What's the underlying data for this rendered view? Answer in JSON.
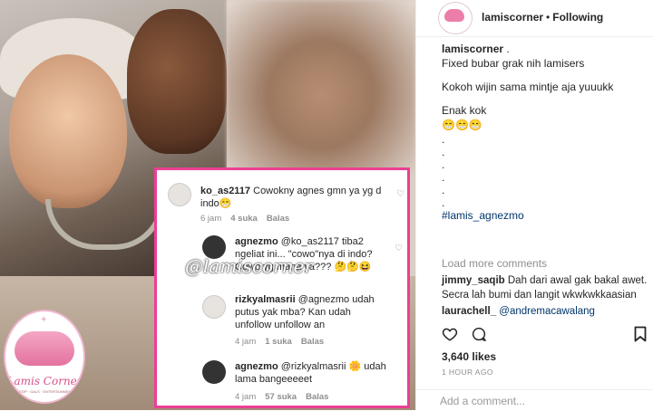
{
  "comment_card": {
    "comments": [
      {
        "user": "ko_as2117",
        "text": "Cowokny agnes gmn ya yg d indo😁",
        "time": "6 jam",
        "likes": "4 suka",
        "reply": "Balas"
      },
      {
        "user": "agnezmo",
        "mention": "@ko_as2117",
        "text": "tiba2 ngeliat ini... \"cowo\"nya di indo? Cowo yg mana ya??? 🤔🤔😆"
      },
      {
        "user": "rizkyalmasrii",
        "mention": "@agnezmo",
        "text": "udah putus yak mba? Kan udah unfollow unfollow an",
        "time": "4 jam",
        "likes": "1 suka",
        "reply": "Balas"
      },
      {
        "user": "agnezmo",
        "mention": "@rizkyalmasrii",
        "text": "🌼 udah lama bangeeeeet",
        "time": "4 jam",
        "likes": "57 suka",
        "reply": "Balas"
      }
    ],
    "watermark": "@lamiscorner"
  },
  "logo": {
    "title": "Lamis Corner",
    "subtitle": "GOSSIP · GALS · ENTERTAINMENTS"
  },
  "header": {
    "username": "lamiscorner",
    "separator": "•",
    "follow_state": "Following"
  },
  "caption": {
    "username": "lamiscorner",
    "suffix": " .",
    "lines": [
      "Fixed bubar grak nih lamisers",
      "Kokoh wijin sama mintje aja yuuukk",
      "Enak kok",
      "😁😁😁"
    ],
    "dots": [
      ".",
      ".",
      ".",
      ".",
      ".",
      "."
    ],
    "hashtag": "#lamis_agnezmo"
  },
  "load_more": "Load more comments",
  "comments": [
    {
      "user": "jimmy_saqib",
      "text": "Dah dari awal gak bakal awet. Secra lah bumi dan langit wkwkwkkaasian"
    },
    {
      "user": "laurachell_",
      "mention": "@andremacawalang"
    }
  ],
  "likes": "3,640 likes",
  "timestamp": "1 HOUR AGO",
  "add_comment": {
    "placeholder": "Add a comment..."
  },
  "colors": {
    "accent": "#ec3f93",
    "link": "#003569",
    "muted": "#8e8e8e"
  },
  "icons": [
    "heart-icon",
    "comment-icon",
    "bookmark-icon"
  ]
}
